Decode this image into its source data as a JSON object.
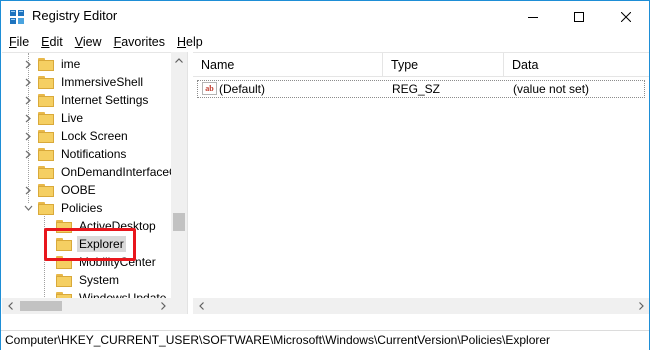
{
  "window": {
    "title": "Registry Editor",
    "colors": {
      "accent": "#1e8ed6",
      "highlight": "#e8161c",
      "selection": "#d9d9d9",
      "folder": "#f5cf62"
    }
  },
  "titlebar_buttons": {
    "minimize": "minimize-icon",
    "maximize": "maximize-icon",
    "close": "close-icon"
  },
  "menu": [
    {
      "label_u": "F",
      "label_rest": "ile"
    },
    {
      "label_u": "E",
      "label_rest": "dit"
    },
    {
      "label_u": "V",
      "label_rest": "iew"
    },
    {
      "label_u": "F",
      "label_rest": "avorites",
      "prefix": ""
    },
    {
      "label_u": "H",
      "label_rest": "elp"
    }
  ],
  "tree": {
    "items": [
      {
        "label": "ime",
        "expander": "collapsed"
      },
      {
        "label": "ImmersiveShell",
        "expander": "collapsed"
      },
      {
        "label": "Internet Settings",
        "expander": "collapsed"
      },
      {
        "label": "Live",
        "expander": "collapsed"
      },
      {
        "label": "Lock Screen",
        "expander": "collapsed"
      },
      {
        "label": "Notifications",
        "expander": "collapsed"
      },
      {
        "label": "OnDemandInterfaceC",
        "expander": "none"
      },
      {
        "label": "OOBE",
        "expander": "collapsed"
      },
      {
        "label": "Policies",
        "expander": "expanded"
      },
      {
        "label": "ActiveDesktop",
        "expander": "none"
      },
      {
        "label": "Explorer",
        "expander": "none",
        "selected": true
      },
      {
        "label": "MobilityCenter",
        "expander": "none"
      },
      {
        "label": "System",
        "expander": "none"
      },
      {
        "label": "WindowsUpdate",
        "expander": "none"
      }
    ]
  },
  "list": {
    "columns": [
      "Name",
      "Type",
      "Data"
    ],
    "rows": [
      {
        "icon": "string-value-icon",
        "icon_text": "ab",
        "name": "(Default)",
        "type": "REG_SZ",
        "data": "(value not set)"
      }
    ]
  },
  "statusbar": {
    "path": "Computer\\HKEY_CURRENT_USER\\SOFTWARE\\Microsoft\\Windows\\CurrentVersion\\Policies\\Explorer"
  }
}
